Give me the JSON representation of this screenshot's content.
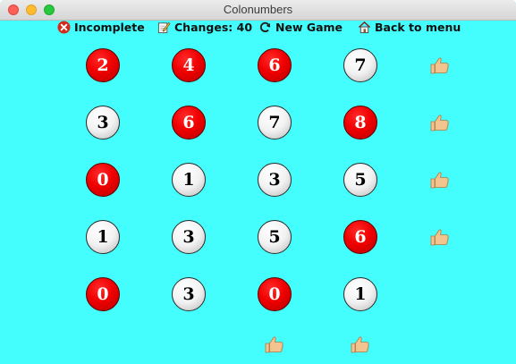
{
  "window": {
    "title": "Colonumbers"
  },
  "toolbar": {
    "status_label": "Incomplete",
    "changes_label": "Changes: 40",
    "new_game_label": "New Game",
    "back_label": "Back to menu"
  },
  "grid": {
    "rows": [
      [
        {
          "value": "2",
          "color": "red"
        },
        {
          "value": "4",
          "color": "red"
        },
        {
          "value": "6",
          "color": "red"
        },
        {
          "value": "7",
          "color": "white"
        }
      ],
      [
        {
          "value": "3",
          "color": "white"
        },
        {
          "value": "6",
          "color": "red"
        },
        {
          "value": "7",
          "color": "white"
        },
        {
          "value": "8",
          "color": "red"
        }
      ],
      [
        {
          "value": "0",
          "color": "red"
        },
        {
          "value": "1",
          "color": "white"
        },
        {
          "value": "3",
          "color": "white"
        },
        {
          "value": "5",
          "color": "white"
        }
      ],
      [
        {
          "value": "1",
          "color": "white"
        },
        {
          "value": "3",
          "color": "white"
        },
        {
          "value": "5",
          "color": "white"
        },
        {
          "value": "6",
          "color": "red"
        }
      ],
      [
        {
          "value": "0",
          "color": "red"
        },
        {
          "value": "3",
          "color": "white"
        },
        {
          "value": "0",
          "color": "red"
        },
        {
          "value": "1",
          "color": "white"
        }
      ]
    ],
    "row_ok": [
      true,
      true,
      true,
      true,
      false
    ],
    "col_ok": [
      false,
      false,
      true,
      true
    ]
  },
  "colors": {
    "background": "#44fdfd",
    "red_ball": "#f00000",
    "white_ball": "#f2f2f2",
    "thumb": "#f2c48f"
  },
  "icons": {
    "status": "x-circle-icon",
    "changes": "pencil-note-icon",
    "new_game": "refresh-icon",
    "back": "home-icon",
    "ok": "thumbs-up-icon"
  }
}
